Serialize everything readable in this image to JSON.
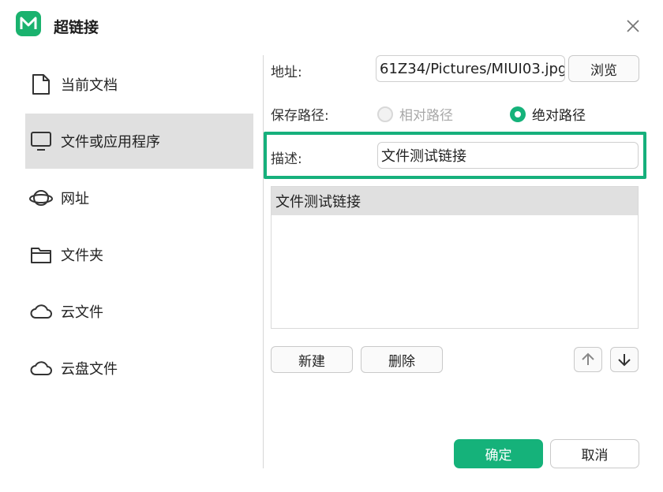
{
  "window": {
    "title": "超链接"
  },
  "sidebar": {
    "items": [
      {
        "label": "当前文档",
        "icon": "document-icon"
      },
      {
        "label": "文件或应用程序",
        "icon": "monitor-icon",
        "active": true
      },
      {
        "label": "网址",
        "icon": "planet-icon"
      },
      {
        "label": "文件夹",
        "icon": "folder-icon"
      },
      {
        "label": "云文件",
        "icon": "cloud-icon"
      },
      {
        "label": "云盘文件",
        "icon": "cloud-drive-icon"
      }
    ]
  },
  "form": {
    "address_label": "地址:",
    "address_value": "61Z34/Pictures/MIUI03.jpg",
    "browse_label": "浏览",
    "save_path_label": "保存路径:",
    "relative_path_label": "相对路径",
    "absolute_path_label": "绝对路径",
    "selected_path": "绝对路径",
    "description_label": "描述:",
    "description_value": "文件测试链接"
  },
  "list": {
    "items": [
      "文件测试链接"
    ]
  },
  "actions": {
    "new_label": "新建",
    "delete_label": "删除",
    "ok_label": "确定",
    "cancel_label": "取消"
  },
  "colors": {
    "accent": "#15b27a",
    "highlight_border": "#16b07c",
    "selected_bg": "#e0e0e0"
  }
}
